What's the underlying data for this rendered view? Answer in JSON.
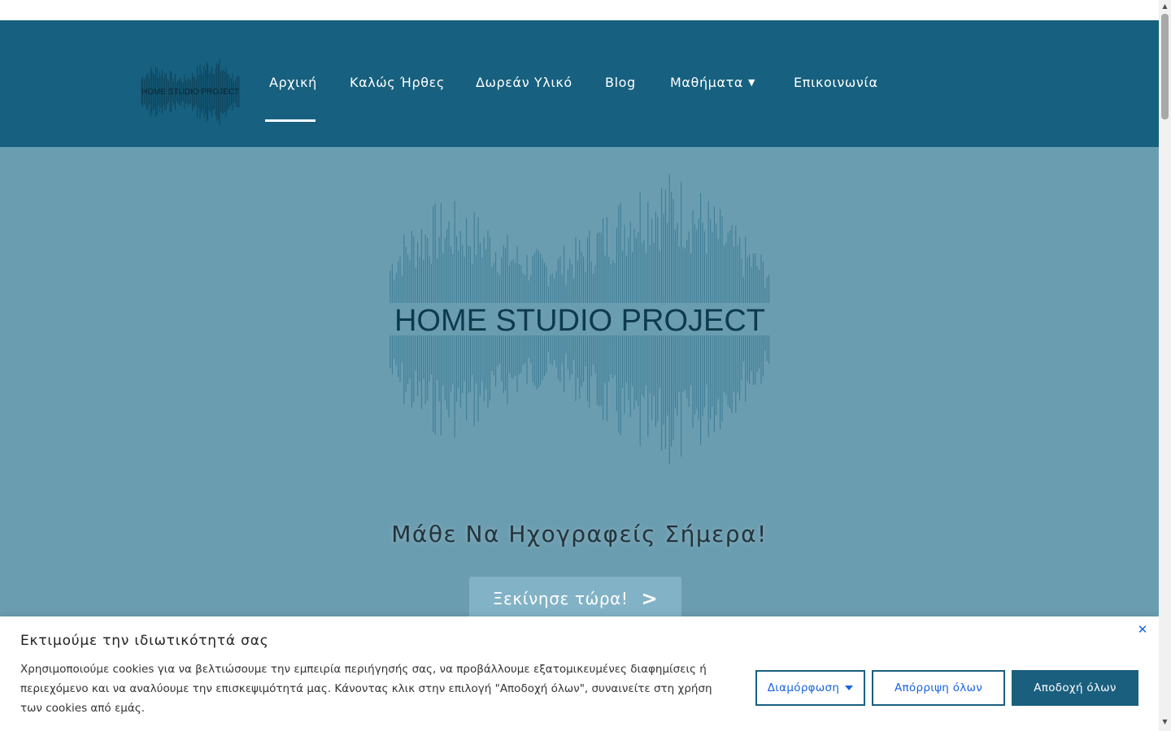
{
  "nav": {
    "items": [
      {
        "label": "Αρχική"
      },
      {
        "label": "Καλώς Ήρθες"
      },
      {
        "label": "Δωρεάν Υλικό"
      },
      {
        "label": "Blog"
      },
      {
        "label": "Μαθήματα"
      },
      {
        "label": "Επικοινωνία"
      }
    ],
    "active": "Αρχική",
    "dropdown_icon": "chevron-down-icon"
  },
  "logo": {
    "text": "HOME STUDIO PROJECT"
  },
  "hero": {
    "logo_text": "HOME STUDIO PROJECT",
    "headline": "Μάθε Να Ηχογραφείς Σήμερα!",
    "cta_label": "Ξεκίνησε τώρα!",
    "cta_arrow": ">"
  },
  "cookie_banner": {
    "title": "Εκτιμούμε την ιδιωτικότητά σας",
    "text": "Χρησιμοποιούμε cookies για να βελτιώσουμε την εμπειρία περιήγησής σας, να προβάλλουμε εξατομικευμένες διαφημίσεις ή περιεχόμενο και να αναλύουμε την επισκεψιμότητά μας. Κάνοντας κλικ στην επιλογή \"Αποδοχή όλων\", συναινείτε στη χρήση των cookies από εμάς.",
    "customize_label": "Διαμόρφωση",
    "reject_label": "Απόρριψη όλων",
    "accept_label": "Αποδοχή όλων",
    "close_icon": "close-icon"
  },
  "colors": {
    "header_bg": "#17607f",
    "hero_bg": "#6b9db0",
    "cta_bg": "#82b2c6",
    "accent_blue": "#1863dc",
    "button_dark": "#1a5f7e"
  }
}
